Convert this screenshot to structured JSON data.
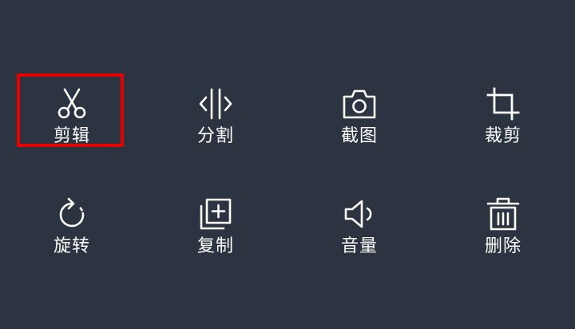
{
  "tools": [
    {
      "label": "剪辑",
      "icon": "scissors-icon"
    },
    {
      "label": "分割",
      "icon": "split-icon"
    },
    {
      "label": "截图",
      "icon": "camera-icon"
    },
    {
      "label": "裁剪",
      "icon": "crop-icon"
    },
    {
      "label": "旋转",
      "icon": "rotate-icon"
    },
    {
      "label": "复制",
      "icon": "copy-icon"
    },
    {
      "label": "音量",
      "icon": "volume-icon"
    },
    {
      "label": "删除",
      "icon": "trash-icon"
    }
  ],
  "selected_tool": "剪辑",
  "colors": {
    "background": "#2b3440",
    "icon": "#ffffff",
    "label": "#ffffff",
    "selection": "#e60000"
  }
}
